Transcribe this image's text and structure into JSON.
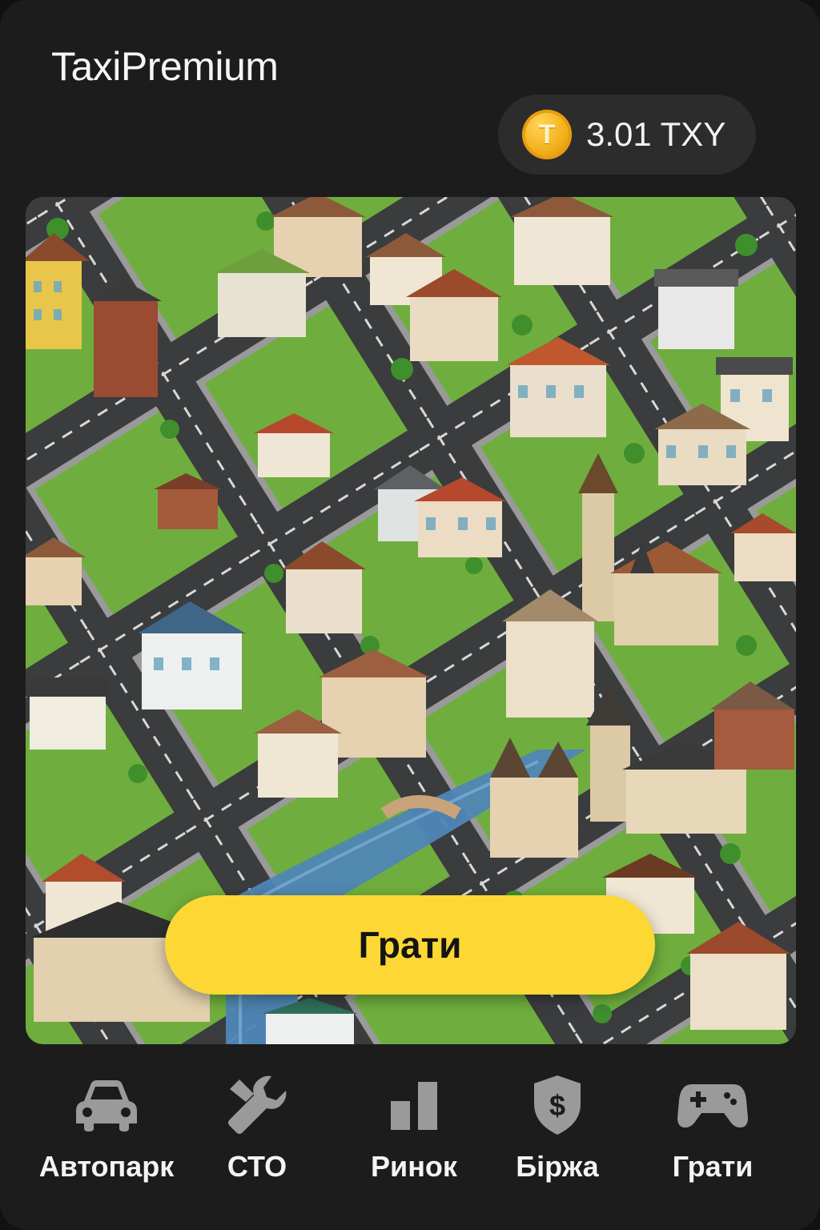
{
  "app": {
    "title": "TaxiPremium"
  },
  "balance": {
    "coin_symbol": "T",
    "amount": "3.01 TXY",
    "icon": "coin-icon"
  },
  "map": {
    "icon": "city-map"
  },
  "play_button": {
    "label": "Грати"
  },
  "nav": {
    "items": [
      {
        "label": "Автопарк",
        "icon": "car-icon"
      },
      {
        "label": "СТО",
        "icon": "wrench-icon"
      },
      {
        "label": "Ринок",
        "icon": "bar-chart-icon"
      },
      {
        "label": "Біржа",
        "icon": "shield-dollar-icon"
      },
      {
        "label": "Грати",
        "icon": "gamepad-icon"
      }
    ]
  },
  "colors": {
    "background": "#1c1c1c",
    "pill": "#2c2c2c",
    "accent_yellow": "#fdd835",
    "coin": "#f3b11a",
    "icon_gray": "#9a9a9a"
  }
}
